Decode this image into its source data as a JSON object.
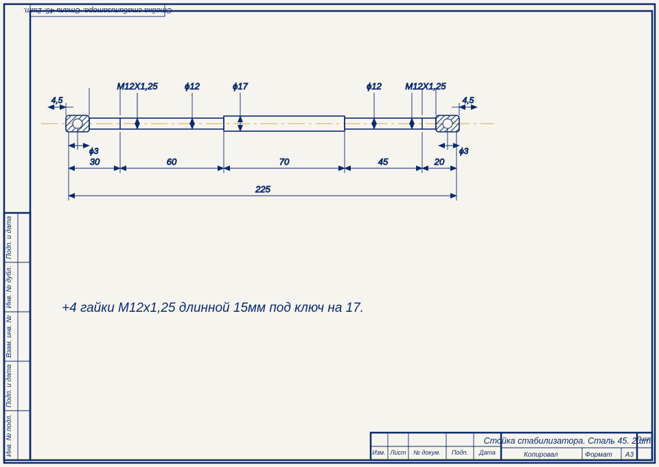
{
  "title_block": {
    "title": "Стойка стабилизатора. Сталь 45. 2шт.",
    "footer_left": "Копировал",
    "format_label": "Формат",
    "format_value": "А3",
    "list_label": "Лист",
    "small_cols": [
      "Изм.",
      "Лист",
      "№ докум.",
      "Подп.",
      "Дата"
    ]
  },
  "side_cells": [
    "Инв. № подл.",
    "Подп. и дата",
    "Взам. инв. №",
    "Инв. № дубл.",
    "Подп. и дата"
  ],
  "top_tab": "Стойка стабилизатора. Сталь 45. 2шт.",
  "note": "+4 гайки М12х1,25 длинной 15мм под ключ на 17.",
  "dim": {
    "d4_5a": "4,5",
    "d4_5b": "4,5",
    "thread_left": "М12Х1,25",
    "thread_right": "М12Х1,25",
    "phi12a": "ϕ12",
    "phi12b": "ϕ12",
    "phi17": "ϕ17",
    "phi3a": "ϕ3",
    "phi3b": "ϕ3",
    "len30": "30",
    "len60": "60",
    "len70": "70",
    "len45": "45",
    "len20": "20",
    "len225": "225"
  }
}
